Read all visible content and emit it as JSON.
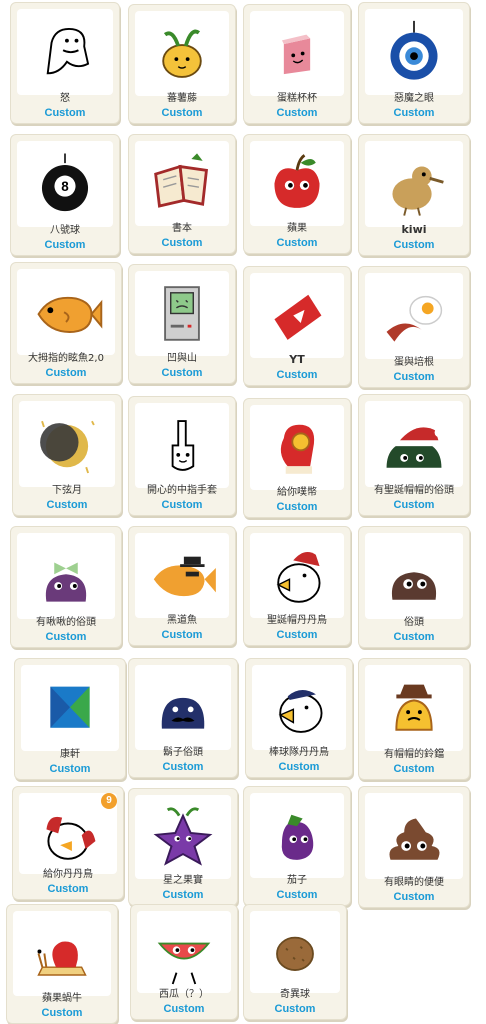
{
  "items": [
    {
      "name": "怒",
      "tag": "Custom",
      "icon": "ghost-doodle-icon"
    },
    {
      "name": "蕃薯藤",
      "tag": "Custom",
      "icon": "sweet-potato-sprout-icon"
    },
    {
      "name": "蛋糕杯杯",
      "tag": "Custom",
      "icon": "cake-cup-icon"
    },
    {
      "name": "惡魔之眼",
      "tag": "Custom",
      "icon": "evil-eye-icon"
    },
    {
      "name": "八號球",
      "tag": "Custom",
      "icon": "eight-ball-icon"
    },
    {
      "name": "書本",
      "tag": "Custom",
      "icon": "book-icon"
    },
    {
      "name": "蘋果",
      "tag": "Custom",
      "icon": "apple-icon"
    },
    {
      "name": "kiwi",
      "tag": "Custom",
      "icon": "kiwi-bird-icon"
    },
    {
      "name": "大拇指的眩魚2,0",
      "tag": "Custom",
      "icon": "taiyaki-icon"
    },
    {
      "name": "凹與山",
      "tag": "Custom",
      "icon": "retro-computer-icon"
    },
    {
      "name": "YT",
      "tag": "Custom",
      "icon": "youtube-play-icon"
    },
    {
      "name": "蛋與培根",
      "tag": "Custom",
      "icon": "egg-bacon-icon"
    },
    {
      "name": "下弦月",
      "tag": "Custom",
      "icon": "moon-icon"
    },
    {
      "name": "開心的中指手套",
      "tag": "Custom",
      "icon": "glove-icon"
    },
    {
      "name": "給你噗幣",
      "tag": "Custom",
      "icon": "mitten-coin-icon"
    },
    {
      "name": "有聖誕帽帽的俗頭",
      "tag": "Custom",
      "icon": "santa-hat-blob-icon"
    },
    {
      "name": "有啾啾的俗頭",
      "tag": "Custom",
      "icon": "bow-blob-icon"
    },
    {
      "name": "黑道魚",
      "tag": "Custom",
      "icon": "gangster-fish-icon"
    },
    {
      "name": "聖誕帽丹丹鳥",
      "tag": "Custom",
      "icon": "santa-bird-icon"
    },
    {
      "name": "俗頭",
      "tag": "Custom",
      "icon": "brown-blob-icon"
    },
    {
      "name": "康軒",
      "tag": "Custom",
      "icon": "k-logo-icon"
    },
    {
      "name": "鬍子俗頭",
      "tag": "Custom",
      "icon": "mustache-blob-icon"
    },
    {
      "name": "棒球隊丹丹鳥",
      "tag": "Custom",
      "icon": "baseball-bird-icon"
    },
    {
      "name": "有帽帽的鈴鐺",
      "tag": "Custom",
      "icon": "hat-bell-icon"
    },
    {
      "name": "給你丹丹鳥",
      "tag": "Custom",
      "icon": "gift-bird-icon",
      "badge": "9"
    },
    {
      "name": "星之果實",
      "tag": "Custom",
      "icon": "star-fruit-icon"
    },
    {
      "name": "茄子",
      "tag": "Custom",
      "icon": "eggplant-icon"
    },
    {
      "name": "有眼睛的便便",
      "tag": "Custom",
      "icon": "poop-icon"
    },
    {
      "name": "蘋果蝸牛",
      "tag": "Custom",
      "icon": "apple-snail-icon"
    },
    {
      "name": "西瓜（？）",
      "tag": "Custom",
      "icon": "watermelon-icon"
    },
    {
      "name": "奇異球",
      "tag": "Custom",
      "icon": "kiwi-ball-icon"
    }
  ]
}
